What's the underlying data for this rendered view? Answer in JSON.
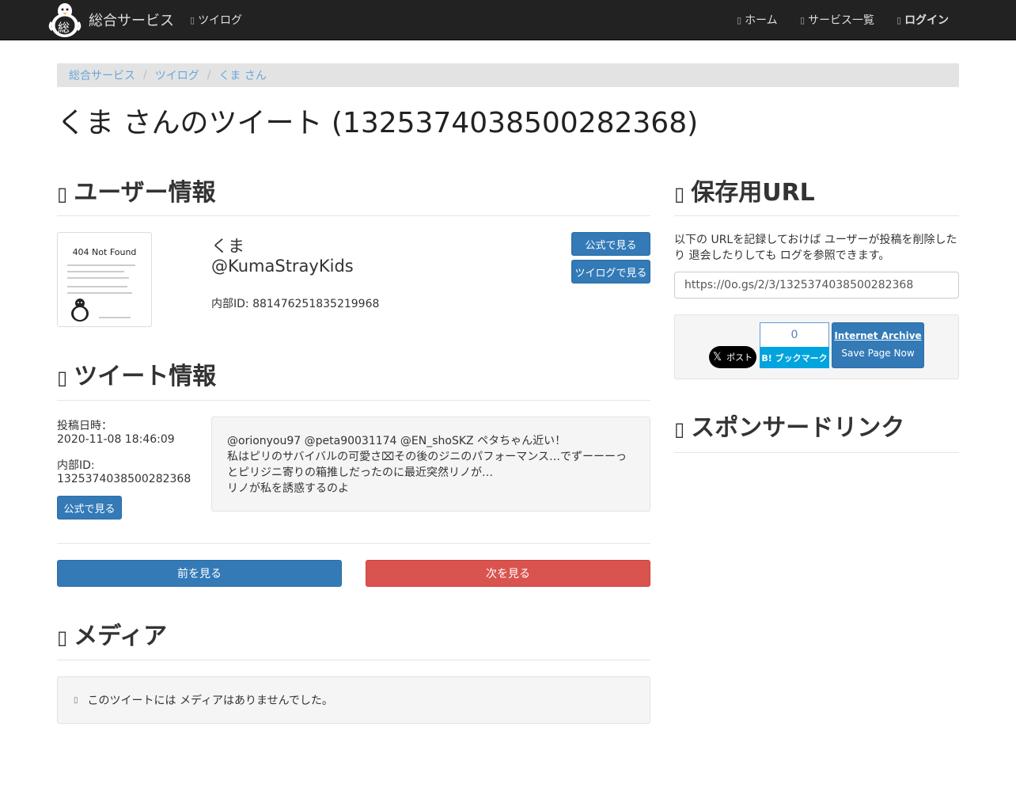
{
  "navbar": {
    "brand": "総合サービス",
    "logo_char": "総",
    "links": [
      {
        "icon": "twitter-icon",
        "label": "ツイログ"
      },
      {
        "icon": "home-icon",
        "label": "ホーム"
      },
      {
        "icon": "list-icon",
        "label": "サービス一覧"
      },
      {
        "icon": "login-icon",
        "label": "ログイン"
      }
    ]
  },
  "breadcrumb": [
    "総合サービス",
    "ツイログ",
    "くま さん"
  ],
  "page_title": "くま さんのツイート (1325374038500282368)",
  "user_section": {
    "heading": "ユーザー情報",
    "thumb_title": "404 Not Found",
    "name": "くま",
    "handle": "@KumaStrayKids",
    "internal_id": "内部ID: 881476251835219968",
    "official_button": "公式で見る",
    "tweetlog_button": "ツイログで見る"
  },
  "tweet_section": {
    "heading": "ツイート情報",
    "posted_label": "投稿日時：",
    "posted_value": "2020-11-08 18:46:09",
    "id_label": "内部ID:",
    "id_value": "1325374038500282368",
    "official_button": "公式で見る",
    "text_lines": [
      "@orionyou97 @peta90031174 @EN_shoSKZ ペタちゃん近い！",
      "私はピリのサバイバルの可愛さ⌧その後のジニのパフォーマンス…でずーーーっ",
      "とピリジニ寄りの箱推しだったのに最近突然リノが…",
      "リノが私を誘惑するのよ"
    ],
    "prev_button": "前を見る",
    "next_button": "次を見る"
  },
  "media_section": {
    "heading": "メディア",
    "message": "このツイートには メディアはありませんでした。"
  },
  "save_section": {
    "heading": "保存用URL",
    "description": "以下の URLを記録しておけば ユーザーが投稿を削除したり 退会したりしても ログを参照できます。",
    "url": "https://0o.gs/2/3/1325374038500282368",
    "x_button_label": "ポスト",
    "hatena_count": "0",
    "hatena_label": "B! ブックマーク",
    "ia_title": "Internet Archive",
    "ia_subtitle": "Save Page Now"
  },
  "sponsor_section": {
    "heading": "スポンサードリンク"
  }
}
